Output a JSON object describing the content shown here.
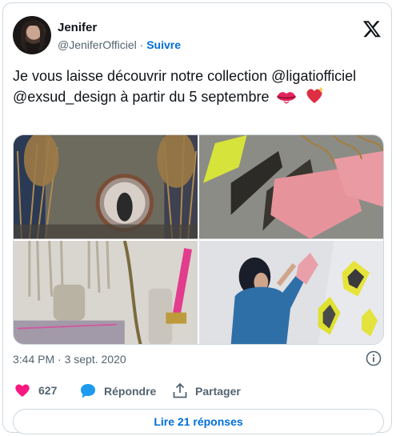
{
  "author": {
    "name": "Jenifer",
    "handle": "@JeniferOfficiel",
    "separator": "·",
    "follow_label": "Suivre"
  },
  "tweet": {
    "text": "Je vous laisse découvrir notre collection @ligatiofficiel @exsud_design à partir du 5 septembre",
    "emojis": [
      "lips-icon",
      "sparkling-heart-icon"
    ]
  },
  "media": {
    "photos": [
      "photo-dried-flowers-mirror",
      "photo-pink-mirrors-wall",
      "photo-macrame-vase",
      "photo-woman-hanging-mirrors"
    ]
  },
  "meta": {
    "timestamp": "3:44 PM · 3 sept. 2020"
  },
  "actions": {
    "like_count": "627",
    "reply_label": "Répondre",
    "share_label": "Partager"
  },
  "replies_button": {
    "label": "Lire 21 réponses"
  },
  "colors": {
    "accent": "#006fd6",
    "like": "#f91880",
    "reply": "#1d9bf0",
    "muted": "#536471",
    "border": "#cfd9de"
  }
}
